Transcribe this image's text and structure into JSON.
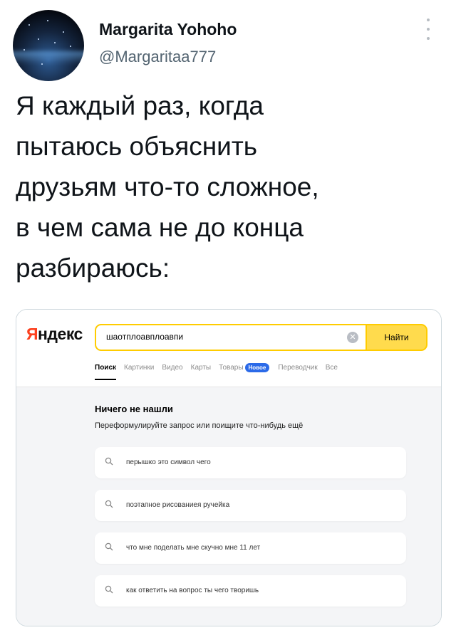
{
  "tweet": {
    "author_name": "Margarita Yohoho",
    "author_handle": "@Margaritaa777",
    "text_lines": [
      "Я каждый раз, когда",
      "пытаюсь объяснить",
      "друзьям что-то сложное,",
      "в чем сама не до конца",
      "разбираюсь:"
    ]
  },
  "screenshot": {
    "logo_first": "Я",
    "logo_rest": "ндекс",
    "search": {
      "value": "шаотплоавплоавпи",
      "button_label": "Найти"
    },
    "tabs": [
      {
        "label": "Поиск",
        "active": true
      },
      {
        "label": "Картинки"
      },
      {
        "label": "Видео"
      },
      {
        "label": "Карты"
      },
      {
        "label": "Товары"
      },
      {
        "label": "Переводчик"
      },
      {
        "label": "Все"
      }
    ],
    "new_badge": "Новое",
    "empty_title": "Ничего не нашли",
    "empty_subtitle": "Переформулируйте запрос или поищите что-нибудь ещё",
    "suggestions": [
      "перышко это символ чего",
      "поэтапное рисованиея ручейка",
      "что мне поделать мне скучно мне 11 лет",
      "как ответить на вопрос ты чего творишь"
    ]
  },
  "colors": {
    "accent_yellow": "#ffdb4d",
    "yandex_red": "#fc3f1d",
    "badge_blue": "#2b6ae8"
  },
  "icons": [
    "more-vertical-icon",
    "clear-icon",
    "search-icon"
  ]
}
